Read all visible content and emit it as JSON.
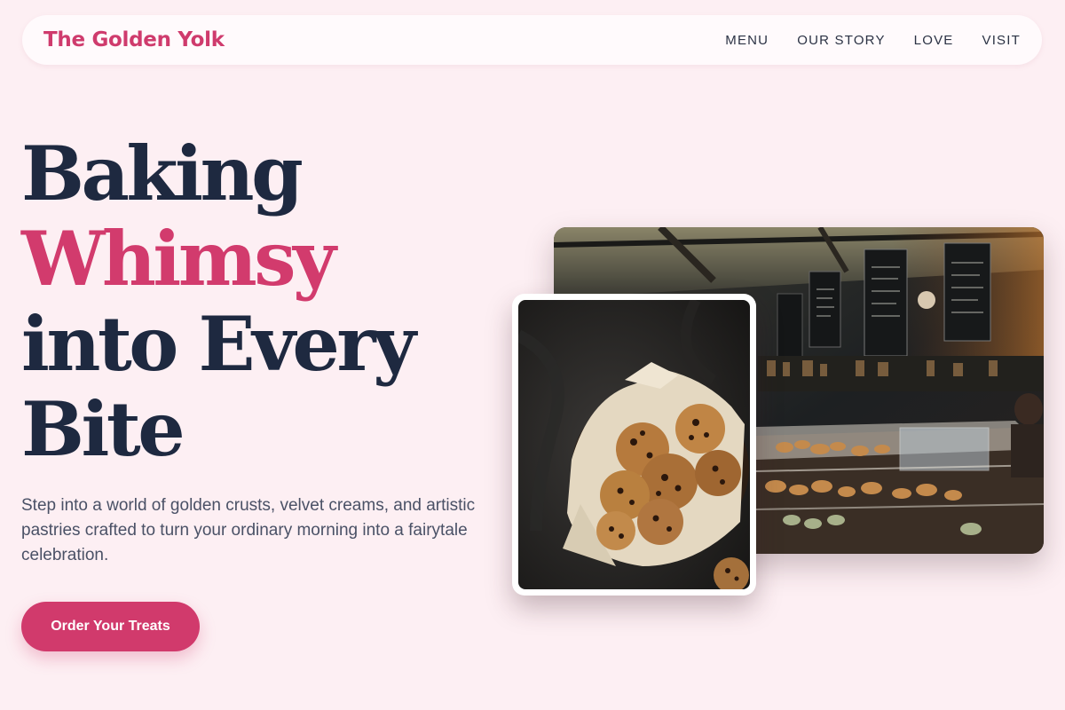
{
  "brand": {
    "name": "The Golden Yolk"
  },
  "nav": {
    "items": [
      "MENU",
      "OUR STORY",
      "LOVE",
      "VISIT"
    ]
  },
  "hero": {
    "headline_line1": "Baking",
    "headline_line2": "Whimsy",
    "headline_line3": "into Every",
    "headline_line4": "Bite",
    "subtitle": "Step into a world of golden crusts, velvet creams, and artistic pastries crafted to turn your ordinary morning into a fairytale celebration.",
    "cta_label": "Order Your Treats"
  },
  "colors": {
    "background": "#fdeff3",
    "accent": "#d13a6c",
    "heading": "#1e2940",
    "body_text": "#4a5166"
  },
  "images": {
    "bakery_interior": "bakery-counter-photo",
    "cookies": "cookies-in-basket-photo"
  }
}
